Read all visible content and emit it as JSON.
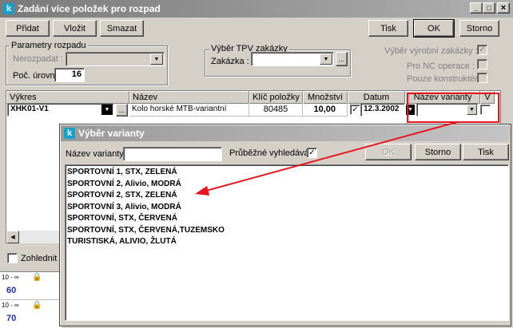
{
  "main_window": {
    "title": "Zadání více položek pro rozpad",
    "controls": {
      "minimize": "_",
      "maximize": "□",
      "close": "×"
    },
    "buttons": {
      "add": "Přidat",
      "insert": "Vložit",
      "delete": "Smazat",
      "print": "Tisk",
      "ok": "OK",
      "cancel": "Storno"
    },
    "parametry": {
      "group_label": "Parametry rozpadu",
      "nerozpadat_label": "Nerozpadat :",
      "nerozpadat_value": "",
      "levels_label": "Poč. úrovní :",
      "levels_value": "16"
    },
    "vyber_tpv": {
      "group_label": "Výběr TPV zakázky",
      "zakazka_label": "Zakázka :",
      "zakazka_value": "",
      "browse": "..."
    },
    "options": {
      "vyrobni_label": "Výběr výrobní zakázky :",
      "vyrobni_checked": "✓",
      "nc_label": "Pro NC operace :",
      "konstrukter_label": "Pouze konstruktér:"
    },
    "table": {
      "headers": [
        "Výkres",
        "Název",
        "Klíč položky",
        "Množství",
        "Datum",
        "Název varianty",
        "V"
      ],
      "row": {
        "vykres": "XHK01-V1",
        "browse": "...",
        "nazev": "Kolo horské MTB-variantní",
        "klic": "80485",
        "mnozstvi": "10,00",
        "datum_check": "✓",
        "datum": "12.3.2002",
        "varianta": "",
        "v": ""
      }
    },
    "zohlednit_label": "Zohlednit te",
    "side_rows": [
      {
        "range": "10 - ∞",
        "value": "60"
      },
      {
        "range": "10 - ∞",
        "value": "70"
      }
    ]
  },
  "popup": {
    "title": "Výběr varianty",
    "name_label": "Název varianty",
    "name_value": "",
    "live_search_label": "Průběžné vyhledávání",
    "live_search_checked": "✓",
    "buttons": {
      "ok": "OK",
      "cancel": "Storno",
      "print": "Tisk"
    },
    "items": [
      "SPORTOVNÍ 1, STX, ZELENÁ",
      "SPORTOVNÍ 2, Alivio, MODRÁ",
      "SPORTOVNÍ 2, STX, ZELENÁ",
      "SPORTOVNÍ 3, Alivio, MODRÁ",
      "SPORTOVNÍ, STX, ČERVENÁ",
      "SPORTOVNÍ, STX, ČERVENÁ,TUZEMSKO",
      "TURISTISKÁ, ALIVIO, ŽLUTÁ"
    ]
  },
  "annotation": {
    "color": "#e8151c"
  }
}
